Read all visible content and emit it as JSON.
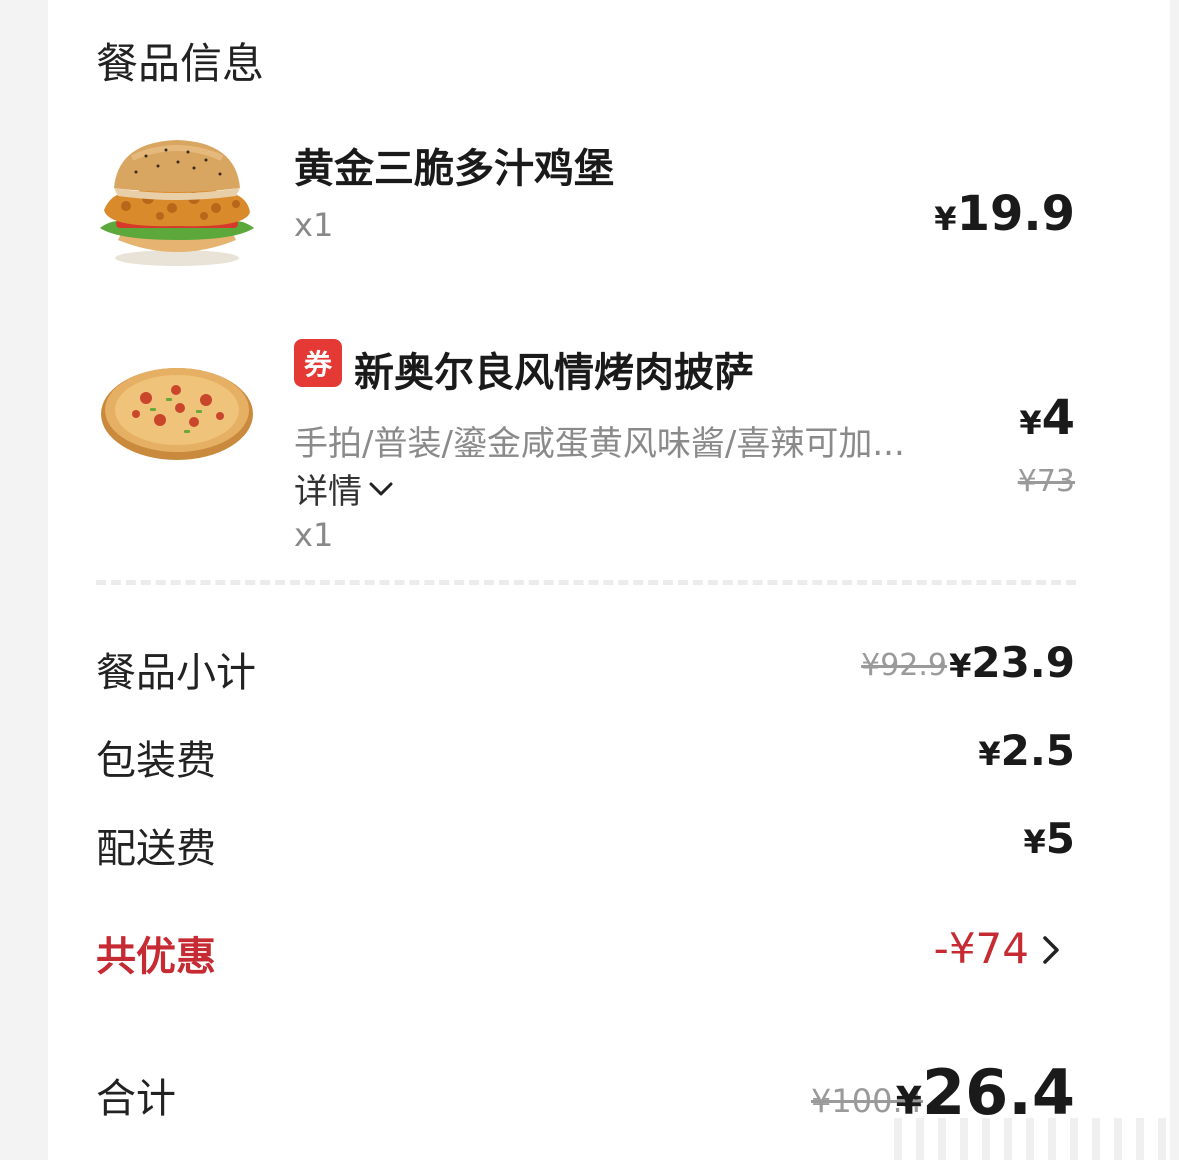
{
  "section_title": "餐品信息",
  "items": [
    {
      "name": "黄金三脆多汁鸡堡",
      "qty": "x1",
      "price": "19.9",
      "currency": "¥"
    },
    {
      "coupon_label": "券",
      "name": "新奥尔良风情烤肉披萨",
      "spec": "手拍/普装/鎏金咸蛋黄风味酱/喜辣可加...",
      "detail_label": "详情",
      "qty": "x1",
      "price": "4",
      "original_price": "¥73",
      "currency": "¥"
    }
  ],
  "summary": {
    "subtotal_label": "餐品小计",
    "subtotal_original": "¥92.9",
    "subtotal_value": "23.9",
    "packaging_label": "包装费",
    "packaging_value": "2.5",
    "delivery_label": "配送费",
    "delivery_value": "5",
    "discount_label": "共优惠",
    "discount_value": "-¥74",
    "total_label": "合计",
    "total_original": "¥100.4",
    "total_value": "26.4",
    "currency": "¥"
  },
  "colors": {
    "accent_red": "#c62b34",
    "coupon_red": "#e53935"
  },
  "icons": {
    "detail_chevron": "chevron-down-icon",
    "discount_chevron": "chevron-right-icon"
  }
}
